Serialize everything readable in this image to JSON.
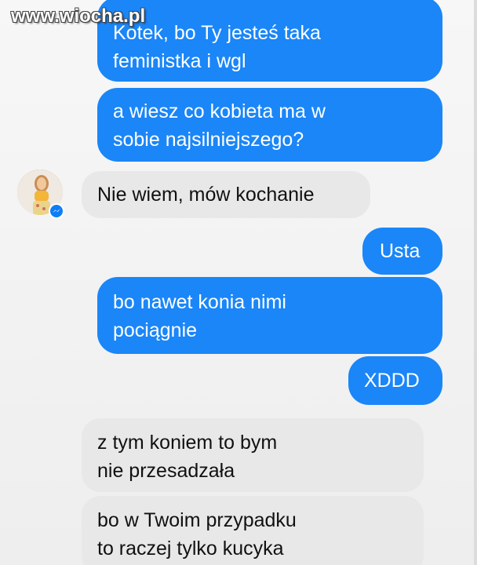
{
  "watermark": "www.wiocha.pl",
  "messages": [
    {
      "dir": "out",
      "text": "Kotek, bo Ty jesteś taka\nfeministka i wgl"
    },
    {
      "dir": "out",
      "text": "a wiesz co kobieta ma w\nsobie najsilniejszego?"
    },
    {
      "dir": "in",
      "text": "Nie wiem, mów kochanie"
    },
    {
      "dir": "out",
      "text": "Usta"
    },
    {
      "dir": "out",
      "text": "bo nawet konia nimi\npociągnie"
    },
    {
      "dir": "out",
      "text": "XDDD"
    },
    {
      "dir": "in",
      "text": "z tym koniem to bym\nnie przesadzała"
    },
    {
      "dir": "in",
      "text": "bo w Twoim przypadku\nto raczej tylko kucyka"
    }
  ],
  "colors": {
    "outgoing": "#1a86f8",
    "incoming": "#e8e8e8",
    "messenger_badge": "#0e7ef5"
  },
  "icons": {
    "avatar": "contact-avatar",
    "badge": "messenger-icon"
  }
}
